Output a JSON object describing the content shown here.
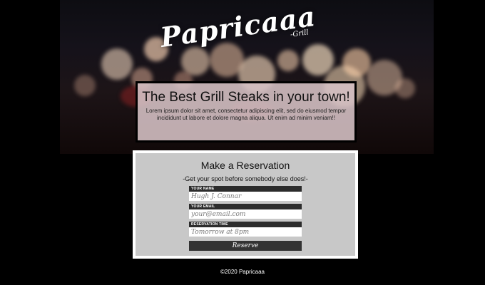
{
  "logo": {
    "name": "Papricaaa",
    "tagline": "-Grill"
  },
  "hero": {
    "headline": "The Best Grill Steaks in your town!",
    "text": "Lorem ipsum dolor sit amet, consectetur adipiscing elit, sed do eiusmod tempor incididunt ut labore et dolore magna aliqua. Ut enim ad minim veniam!!"
  },
  "reservation": {
    "title": "Make a Reservation",
    "subtitle": "-Get your spot before somebody else does!-",
    "name_label": "YOUR NAME",
    "name_placeholder": "Hugh J. Connar",
    "email_label": "YOUR EMAIL",
    "email_placeholder": "your@email.com",
    "time_label": "RESERVATION TIME",
    "time_placeholder": "Tomorrow at 8pm",
    "button": "Reserve"
  },
  "footer": {
    "copyright": "©2020 Papricaaa"
  },
  "colors": {
    "page_bg": "#000000",
    "card_bg": "#c8c8c8",
    "label_bg": "#2c2c2c",
    "button_bg": "#333333"
  }
}
